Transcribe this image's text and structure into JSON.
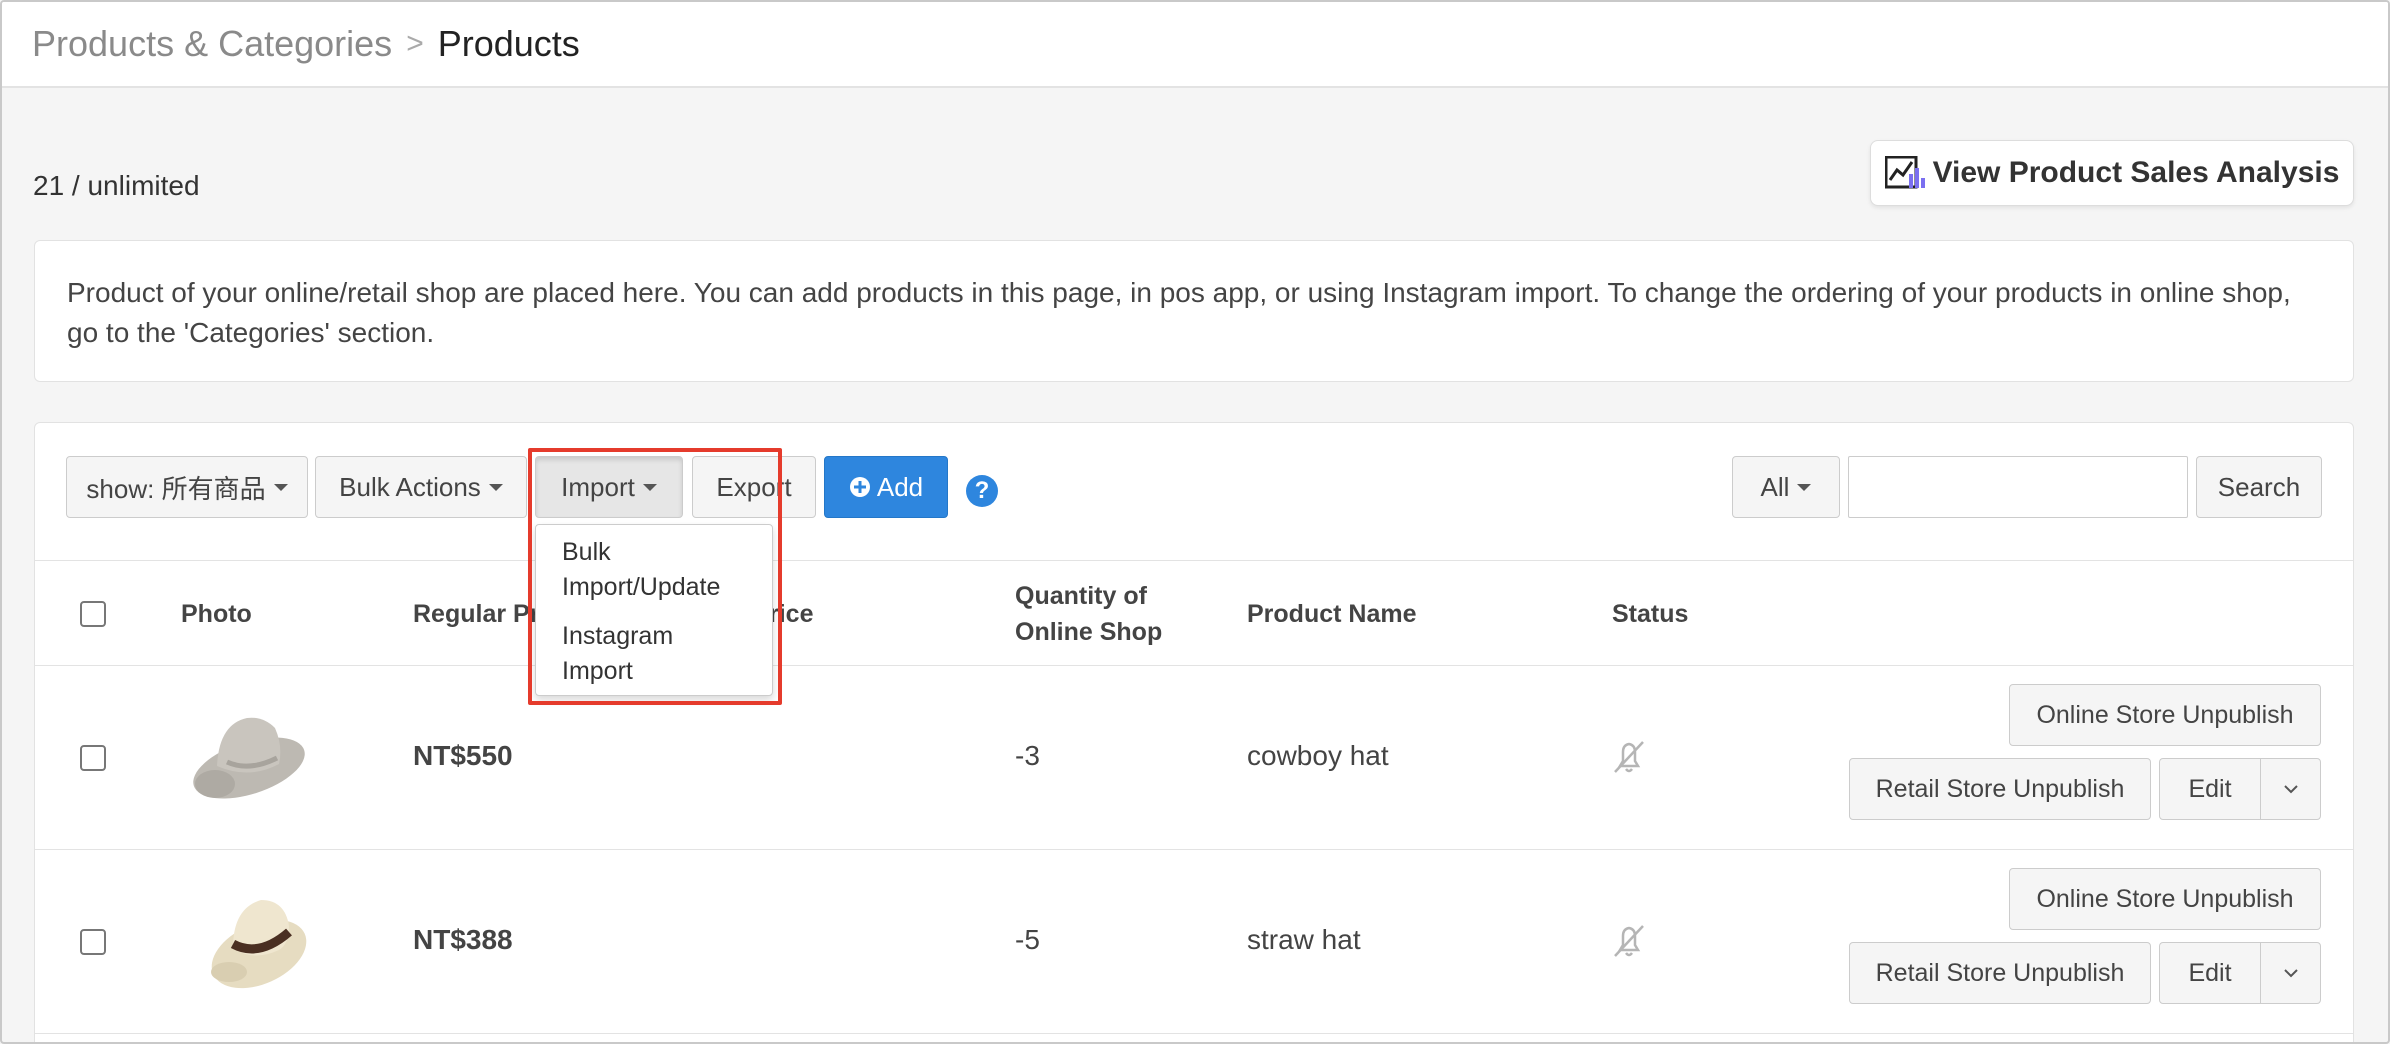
{
  "breadcrumb": {
    "root": "Products & Categories",
    "separator": ">",
    "current": "Products"
  },
  "count_text": "21 / unlimited",
  "analysis_button": "View Product Sales Analysis",
  "info_text": "Product of your online/retail shop are placed here. You can add products in this page, in pos app, or using Instagram import. To change the ordering of your products in online shop, go to the 'Categories' section.",
  "toolbar": {
    "show_filter": "show: 所有商品",
    "bulk_actions": "Bulk Actions",
    "import": "Import",
    "export": "Export",
    "add": "Add",
    "help": "?",
    "scope": "All",
    "search_placeholder": "",
    "search": "Search"
  },
  "import_menu": {
    "items": [
      "Bulk Import/Update",
      "Instagram Import"
    ],
    "item_lines": [
      [
        "Bulk",
        "Import/Update"
      ],
      [
        "Instagram",
        "Import"
      ]
    ]
  },
  "table": {
    "headers": {
      "photo": "Photo",
      "regular_price": "Regular Pr",
      "price_tail": "rice",
      "qty_line1": "Quantity of",
      "qty_line2": "Online Shop",
      "product_name": "Product Name",
      "status": "Status"
    },
    "rows": [
      {
        "price": "NT$550",
        "quantity": "-3",
        "name": "cowboy hat"
      },
      {
        "price": "NT$388",
        "quantity": "-5",
        "name": "straw hat"
      }
    ],
    "actions": {
      "online_unpublish": "Online Store Unpublish",
      "retail_unpublish": "Retail Store Unpublish",
      "edit": "Edit"
    }
  },
  "colors": {
    "accent": "#2e86de",
    "highlight": "#e53b2c"
  }
}
